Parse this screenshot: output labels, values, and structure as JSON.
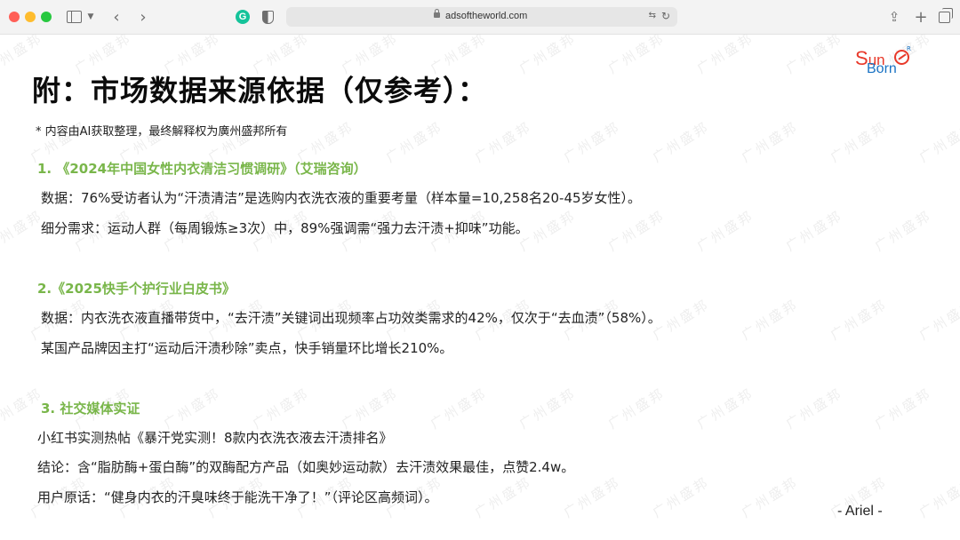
{
  "browser": {
    "url": "adsoftheworld.com",
    "grammarly_letter": "G",
    "translate_glyph": "⇆",
    "reload_glyph": "↻"
  },
  "slide": {
    "title": "附：市场数据来源依据（仅参考）：",
    "note": "* 内容由AI获取整理，最终解释权为廣州盛邦所有",
    "logo": {
      "line1_first": "S",
      "line1_rest": "un",
      "line2": "Born",
      "mark": "R"
    },
    "watermark_text": "广州盛邦",
    "sections": [
      {
        "heading": "1. 《2024年中国女性内衣清洁习惯调研》（艾瑞咨询）",
        "lines": [
          "数据：76%受访者认为“汗渍清洁”是选购内衣洗衣液的重要考量（样本量=10,258名20-45岁女性）。",
          "细分需求：运动人群（每周锻炼≥3次）中，89%强调需“强力去汗渍+抑味”功能。"
        ]
      },
      {
        "heading": "2.《2025快手个护行业白皮书》",
        "lines": [
          "数据：内衣洗衣液直播带货中，“去汗渍”关键词出现频率占功效类需求的42%，仅次于“去血渍”（58%）。",
          "某国产品牌因主打“运动后汗渍秒除”卖点，快手销量环比增长210%。"
        ]
      },
      {
        "heading": "3. 社交媒体实证",
        "lines": [
          "小红书实测热帖《暴汗党实测！8款内衣洗衣液去汗渍排名》",
          "结论：含“脂肪酶+蛋白酶”的双酶配方产品（如奥妙运动款）去汗渍效果最佳，点赞2.4w。",
          "用户原话：“健身内衣的汗臭味终于能洗干净了！”（评论区高频词）。"
        ]
      }
    ],
    "signature": "- Ariel -"
  },
  "colors": {
    "heading_green": "#79b64a",
    "logo_red": "#e8392a",
    "logo_blue": "#1a73c4"
  }
}
